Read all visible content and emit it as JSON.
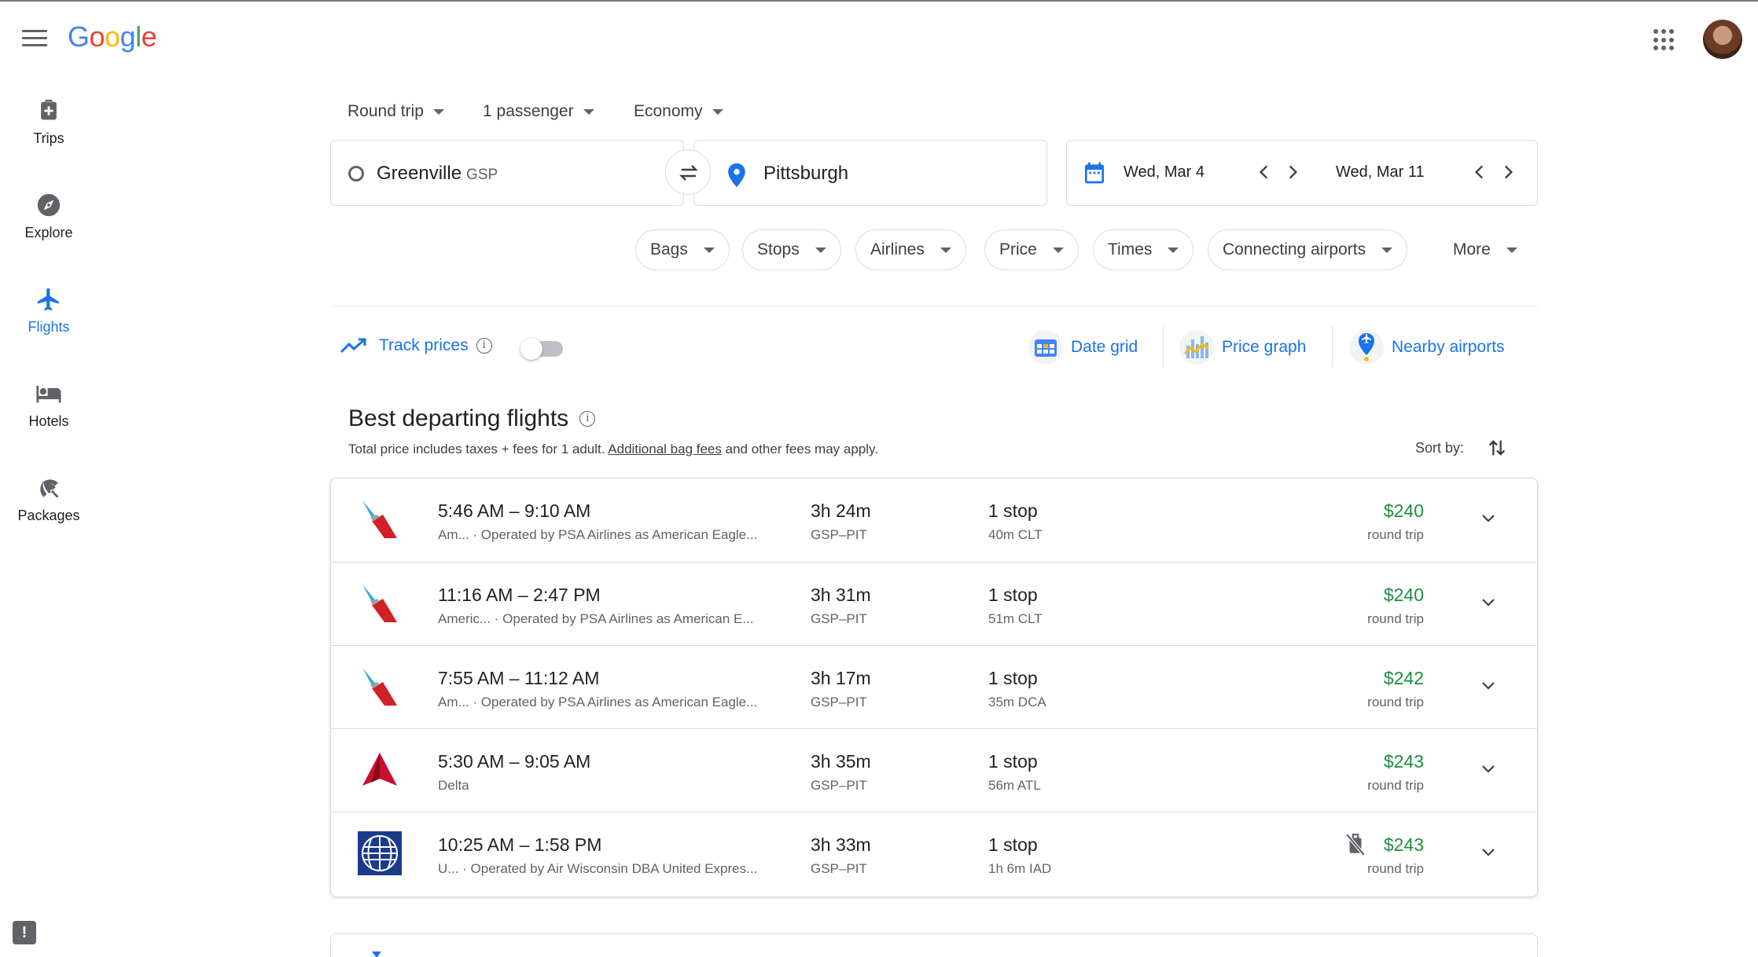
{
  "header": {
    "logo": "Google",
    "logo_colors": [
      "#4285F4",
      "#EA4335",
      "#FBBC05",
      "#4285F4",
      "#34A853",
      "#EA4335"
    ]
  },
  "nav": {
    "items": [
      {
        "label": "Trips",
        "icon": "luggage-icon"
      },
      {
        "label": "Explore",
        "icon": "compass-icon"
      },
      {
        "label": "Flights",
        "icon": "airplane-icon",
        "active": true
      },
      {
        "label": "Hotels",
        "icon": "bed-icon"
      },
      {
        "label": "Packages",
        "icon": "beach-umbrella-icon"
      }
    ]
  },
  "search": {
    "trip_type": "Round trip",
    "passengers": "1 passenger",
    "cabin": "Economy",
    "origin": "Greenville",
    "origin_code": "GSP",
    "destination": "Pittsburgh",
    "depart_date": "Wed, Mar 4",
    "return_date": "Wed, Mar 11"
  },
  "filters": [
    "Bags",
    "Stops",
    "Airlines",
    "Price",
    "Times",
    "Connecting airports",
    "More"
  ],
  "tools": {
    "track_prices": "Track prices",
    "track_enabled": false,
    "date_grid": "Date grid",
    "price_graph": "Price graph",
    "nearby_airports": "Nearby airports"
  },
  "section": {
    "title": "Best departing flights",
    "note_before": "Total price includes taxes + fees for 1 adult. ",
    "note_link": "Additional bag fees",
    "note_after": " and other fees may apply.",
    "sort_label": "Sort by:"
  },
  "colors": {
    "accent": "#1a73e8",
    "price": "#1e8e3e",
    "american_blue": "#36A9E0",
    "american_red": "#D22027",
    "delta_red": "#C8102E",
    "united_blue": "#1A3A8C"
  },
  "flights": [
    {
      "times": "5:46 AM – 9:10 AM",
      "airline": "Am...",
      "operated": "Operated by PSA Airlines as American Eagle...",
      "duration": "3h 24m",
      "route": "GSP–PIT",
      "stops": "1 stop",
      "layover": "40m CLT",
      "price": "$240",
      "trip": "round trip",
      "logo": "american-airlines-logo"
    },
    {
      "times": "11:16 AM – 2:47 PM",
      "airline": "Americ...",
      "operated": "Operated by PSA Airlines as American E...",
      "duration": "3h 31m",
      "route": "GSP–PIT",
      "stops": "1 stop",
      "layover": "51m CLT",
      "price": "$240",
      "trip": "round trip",
      "logo": "american-airlines-logo"
    },
    {
      "times": "7:55 AM – 11:12 AM",
      "airline": "Am...",
      "operated": "Operated by PSA Airlines as American Eagle...",
      "duration": "3h 17m",
      "route": "GSP–PIT",
      "stops": "1 stop",
      "layover": "35m DCA",
      "price": "$242",
      "trip": "round trip",
      "logo": "american-airlines-logo"
    },
    {
      "times": "5:30 AM – 9:05 AM",
      "airline": "Delta",
      "operated": "",
      "duration": "3h 35m",
      "route": "GSP–PIT",
      "stops": "1 stop",
      "layover": "56m ATL",
      "price": "$243",
      "trip": "round trip",
      "logo": "delta-logo"
    },
    {
      "times": "10:25 AM – 1:58 PM",
      "airline": "U...",
      "operated": "Operated by Air Wisconsin DBA United Expres...",
      "duration": "3h 33m",
      "route": "GSP–PIT",
      "stops": "1 stop",
      "layover": "1h 6m IAD",
      "price": "$243",
      "trip": "round trip",
      "logo": "united-logo",
      "no_carry_on": true
    }
  ]
}
